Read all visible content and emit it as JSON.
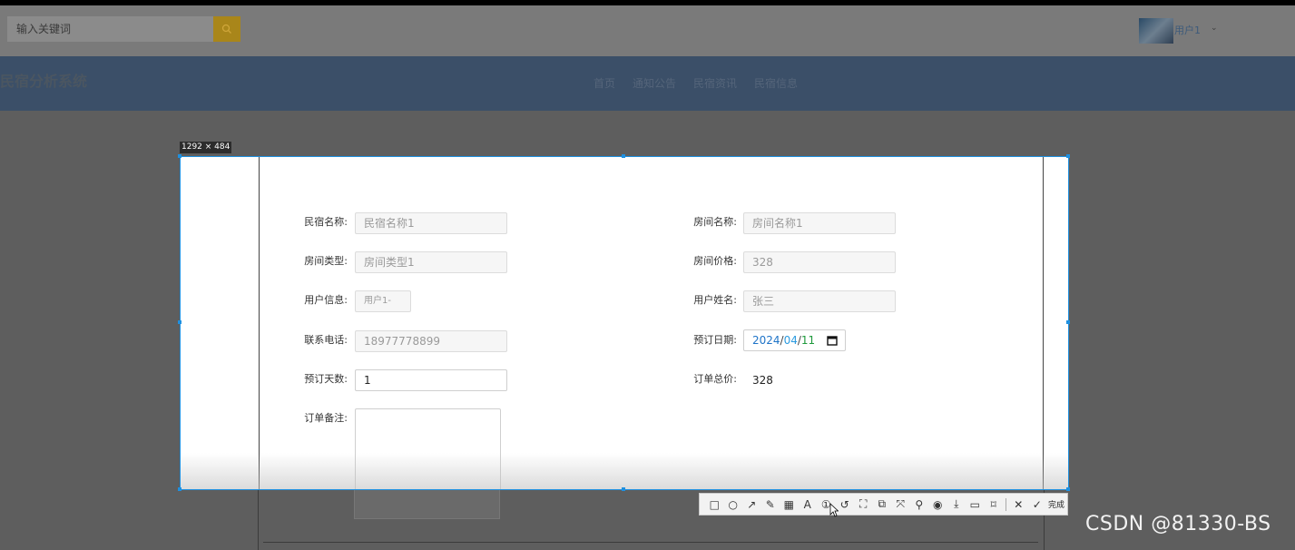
{
  "header": {
    "search": {
      "placeholder": "输入关键词"
    },
    "user": {
      "name": "用户1"
    }
  },
  "nav": {
    "site_title": "民宿分析系统",
    "items": [
      {
        "label": "首页"
      },
      {
        "label": "通知公告"
      },
      {
        "label": "民宿资讯"
      },
      {
        "label": "民宿信息"
      }
    ]
  },
  "screenshot_tool": {
    "size_label": "1292 × 484",
    "done_label": "完成"
  },
  "form": {
    "fields": [
      {
        "label": "民宿名称:",
        "value": "民宿名称1"
      },
      {
        "label": "房间名称:",
        "value": "房间名称1"
      },
      {
        "label": "房间类型:",
        "value": "房间类型1"
      },
      {
        "label": "房间价格:",
        "value": "328"
      },
      {
        "label": "用户信息:",
        "value": "用户1-"
      },
      {
        "label": "用户姓名:",
        "value": "张三"
      },
      {
        "label": "联系电话:",
        "value": "18977778899"
      },
      {
        "label": "预订日期:",
        "value_year": "2024",
        "value_month": "04",
        "value_day": "11",
        "sep": "/"
      },
      {
        "label": "预订天数:",
        "value": "1"
      },
      {
        "label": "订单总价:",
        "value": "328"
      },
      {
        "label": "订单备注:",
        "value": ""
      }
    ]
  },
  "watermark": "CSDN @81330-BS",
  "colors": {
    "capture_border": "#1e90e0",
    "navbar": "#3b4f68",
    "search_button": "#a9861a"
  }
}
